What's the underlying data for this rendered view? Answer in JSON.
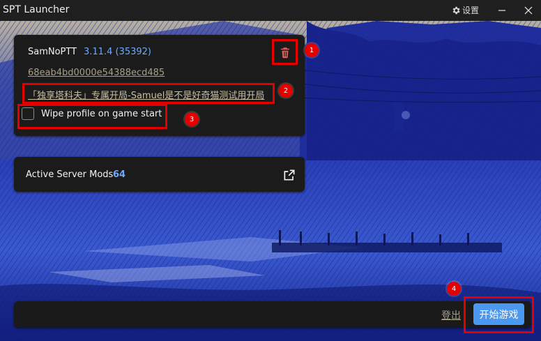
{
  "app": {
    "title": "SPT Launcher",
    "settings_label": "设置",
    "settings_icon": "gear-icon",
    "minimize_icon": "minimize-icon",
    "close_icon": "close-icon"
  },
  "profile": {
    "username": "SamNoPTT",
    "version": "3.11.4 (35392)",
    "profile_id": "68eab4bd0000e54388ecd485",
    "edition": "「独享塔科夫」专属开局-Samuel是不是好奇猫测试用开局",
    "delete_icon": "trash-icon",
    "wipe_label": "Wipe profile on game start",
    "wipe_checked": false
  },
  "mods": {
    "label": "Active Server Mods",
    "count": "64",
    "external_icon": "external-link-icon"
  },
  "bottom": {
    "logout_label": "登出",
    "start_label": "开始游戏"
  },
  "annotations": [
    "1",
    "2",
    "3",
    "4"
  ],
  "colors": {
    "accent": "#4a98f0",
    "version": "#6ea8ff",
    "link": "#a89f88",
    "annotation": "#e50000",
    "delete": "#e05a5a"
  }
}
